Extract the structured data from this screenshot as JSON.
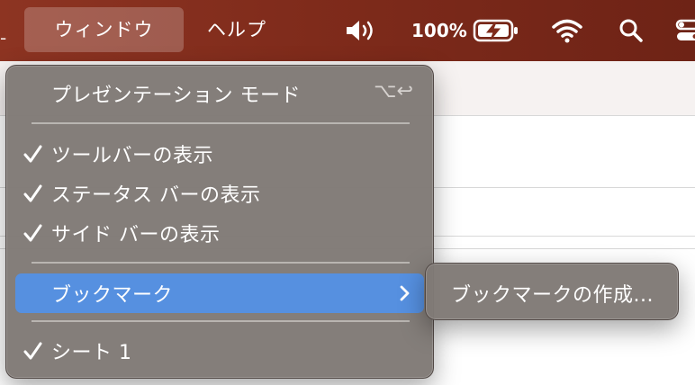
{
  "menubar": {
    "menus": [
      {
        "label": "ウィンドウ"
      },
      {
        "label": "ヘルプ"
      }
    ],
    "status": {
      "battery_percent": "100%",
      "icons": [
        "volume-icon",
        "battery-charging-icon",
        "wifi-icon",
        "search-icon",
        "control-center-icon"
      ]
    }
  },
  "window_menu": {
    "items": [
      {
        "label": "プレゼンテーション モード",
        "shortcut": "⌥↩"
      },
      {
        "label": "ツールバーの表示"
      },
      {
        "label": "ステータス バーの表示"
      },
      {
        "label": "サイド バーの表示"
      },
      {
        "label": "ブックマーク"
      },
      {
        "label": "シート 1"
      }
    ]
  },
  "bookmark_submenu": {
    "items": [
      {
        "label": "ブックマークの作成..."
      }
    ]
  },
  "colors": {
    "menubar_bg": "#7f2b1b",
    "menu_bg": "#807a76",
    "highlight": "#5690e0"
  }
}
